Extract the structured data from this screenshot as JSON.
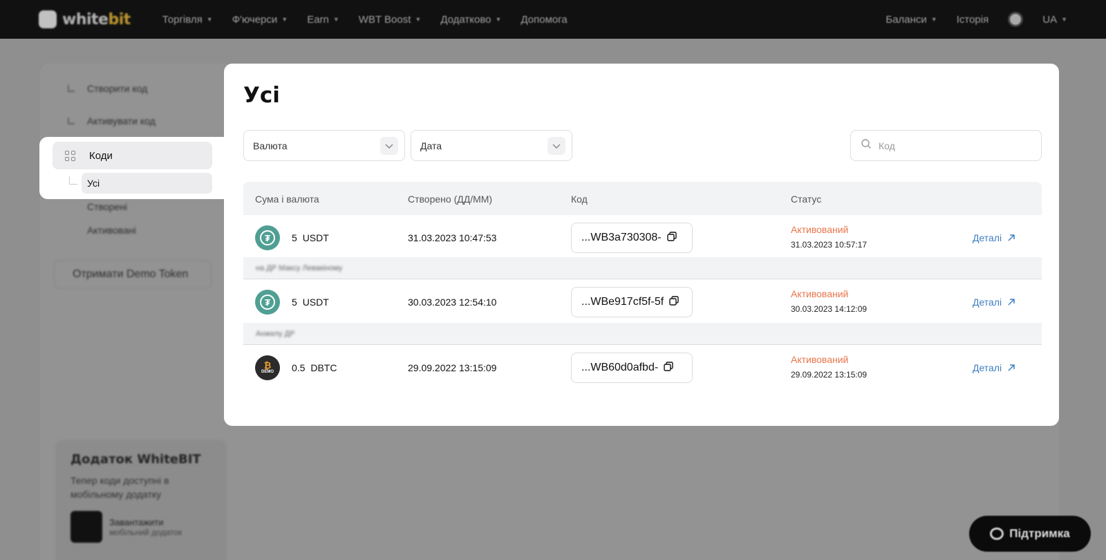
{
  "topbar": {
    "logo_white": "white",
    "logo_brand": "bit",
    "nav": [
      "Торгівля",
      "Ф'ючерси",
      "Earn",
      "WBT Boost",
      "Додатково",
      "Допомога"
    ],
    "right_balances": "Баланси",
    "right_history": "Історія",
    "right_lang": "UA"
  },
  "sidebar": {
    "create": "Створити код",
    "activate": "Активувати код",
    "codes": "Коди",
    "all": "Усі",
    "created": "Створені",
    "activated": "Активовані",
    "demo_button": "Отримати Demo Token"
  },
  "app_card": {
    "title": "Додаток WhiteBIT",
    "text": "Тепер коди доступні в мобільному додатку",
    "download": "Завантажити",
    "download_sub": "мобільний додаток"
  },
  "support": {
    "label": "Підтримка"
  },
  "modal": {
    "title": "Усі",
    "filter_currency": "Валюта",
    "filter_date": "Дата",
    "search_placeholder": "Код",
    "columns": {
      "amount": "Сума і валюта",
      "created": "Створено (ДД/ММ)",
      "code": "Код",
      "status": "Статус"
    },
    "rows": [
      {
        "amount": "5",
        "currency": "USDT",
        "icon": "usdt-coin-icon",
        "created": "31.03.2023 10:47:53",
        "code": "...WB3a730308-",
        "status": "Активований",
        "status_date": "31.03.2023 10:57:17",
        "details": "Деталі"
      },
      {
        "amount": "5",
        "currency": "USDT",
        "icon": "usdt-coin-icon",
        "created": "30.03.2023 12:54:10",
        "code": "...WBe917cf5f-5f",
        "status": "Активований",
        "status_date": "30.03.2023 14:12:09",
        "details": "Деталі"
      },
      {
        "amount": "0.5",
        "currency": "DBTC",
        "icon": "demo-btc-coin-icon",
        "created": "29.09.2022 13:15:09",
        "code": "...WB60d0afbd-",
        "status": "Активований",
        "status_date": "29.09.2022 13:15:09",
        "details": "Деталі"
      }
    ],
    "notes": [
      "на ДР Максу Левакіному",
      "Анжелу ДР"
    ]
  },
  "colors": {
    "status_activated": "#e8754a",
    "link": "#3f7ec3",
    "usdt": "#4f9f93"
  }
}
